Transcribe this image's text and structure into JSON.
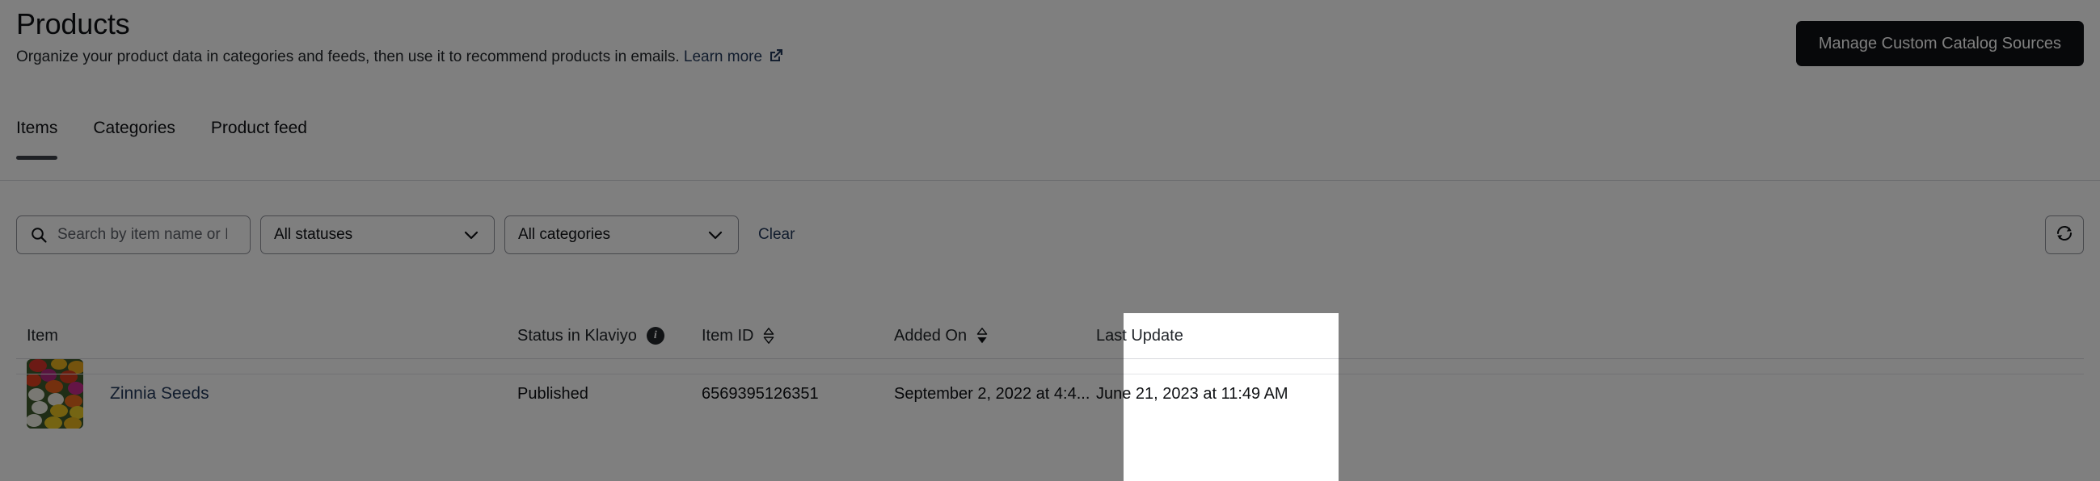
{
  "header": {
    "title": "Products",
    "subtitle": "Organize your product data in categories and feeds, then use it to recommend products in emails.",
    "learn_more_label": "Learn more",
    "primary_button_label": "Manage Custom Catalog Sources"
  },
  "tabs": [
    {
      "label": "Items",
      "active": true
    },
    {
      "label": "Categories",
      "active": false
    },
    {
      "label": "Product feed",
      "active": false
    }
  ],
  "filters": {
    "search_placeholder": "Search by item name or ID",
    "search_value": "",
    "status_select": "All statuses",
    "category_select": "All categories",
    "clear_label": "Clear",
    "refresh_icon": "refresh-icon"
  },
  "table": {
    "columns": [
      {
        "label": "Item",
        "sortable": false,
        "sort": "none",
        "highlighted": false
      },
      {
        "label": "Status in Klaviyo",
        "sortable": false,
        "sort": "none",
        "highlighted": false,
        "info": true
      },
      {
        "label": "Item ID",
        "sortable": true,
        "sort": "none",
        "highlighted": true
      },
      {
        "label": "Added On",
        "sortable": true,
        "sort": "descending",
        "highlighted": false
      },
      {
        "label": "Last Update",
        "sortable": false,
        "sort": "none",
        "highlighted": false
      }
    ],
    "rows": [
      {
        "item_name": "Zinnia Seeds",
        "thumbnail": "zinnia-flowers-thumbnail",
        "status": "Published",
        "item_id": "6569395126351",
        "added_on": "September 2, 2022 at 4:4...",
        "last_update": "June 21, 2023 at 11:49 AM"
      }
    ]
  },
  "colors": {
    "accent_link": "#23395b",
    "button_dark": "#0f1114",
    "border": "#8e9199",
    "scrim": "rgba(0,0,0,0.5)"
  }
}
